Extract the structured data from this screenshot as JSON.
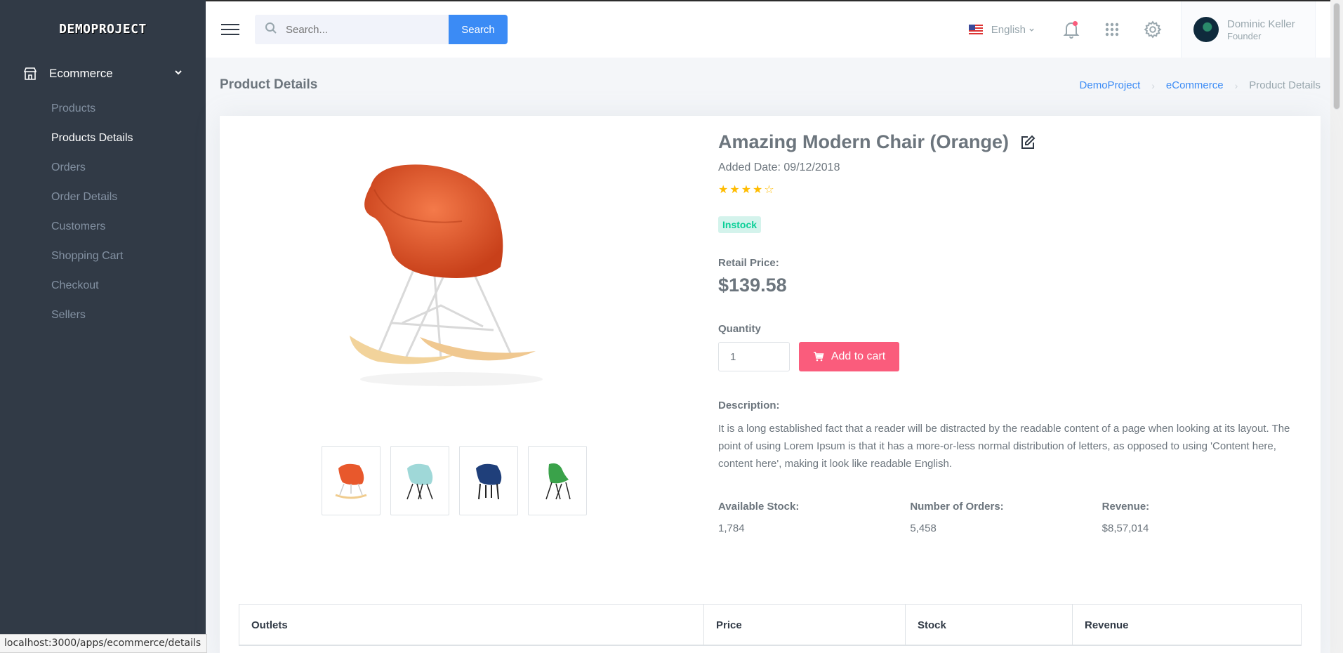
{
  "brand": "DEMOPROJECT",
  "sidebar": {
    "section": "Ecommerce",
    "items": [
      {
        "label": "Products"
      },
      {
        "label": "Products Details"
      },
      {
        "label": "Orders"
      },
      {
        "label": "Order Details"
      },
      {
        "label": "Customers"
      },
      {
        "label": "Shopping Cart"
      },
      {
        "label": "Checkout"
      },
      {
        "label": "Sellers"
      }
    ],
    "active_index": 1
  },
  "topbar": {
    "search_placeholder": "Search...",
    "search_button": "Search",
    "language": "English",
    "user": {
      "name": "Dominic Keller",
      "role": "Founder"
    }
  },
  "page": {
    "title": "Product Details",
    "breadcrumb": [
      "DemoProject",
      "eCommerce",
      "Product Details"
    ]
  },
  "product": {
    "name": "Amazing Modern Chair (Orange)",
    "added_date": "Added Date: 09/12/2018",
    "rating": 4,
    "rating_max": 5,
    "status": "Instock",
    "retail_label": "Retail Price:",
    "price": "$139.58",
    "quantity_label": "Quantity",
    "quantity": "1",
    "add_to_cart": "Add to cart",
    "description_label": "Description:",
    "description": "It is a long established fact that a reader will be distracted by the readable content of a page when looking at its layout. The point of using Lorem Ipsum is that it has a more-or-less normal distribution of letters, as opposed to using 'Content here, content here', making it look like readable English.",
    "stats": [
      {
        "label": "Available Stock:",
        "value": "1,784"
      },
      {
        "label": "Number of Orders:",
        "value": "5,458"
      },
      {
        "label": "Revenue:",
        "value": "$8,57,014"
      }
    ],
    "thumbnail_colors": [
      "#e8582c",
      "#9fd8d8",
      "#1f3f7a",
      "#3aa24a"
    ]
  },
  "table": {
    "headers": [
      "Outlets",
      "Price",
      "Stock",
      "Revenue"
    ]
  },
  "status_url": "localhost:3000/apps/ecommerce/details",
  "colors": {
    "sidebar": "#313a46",
    "primary": "#3b8bf5",
    "danger": "#fa5c7c",
    "success": "#0acf97",
    "star": "#ffbc00"
  }
}
